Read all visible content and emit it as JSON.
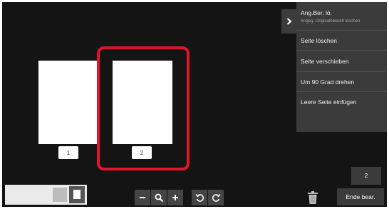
{
  "sidebar": {
    "items": [
      {
        "label": "Ang.Ber. lö.",
        "sublabel": "Angeg. Originalbereich löschen"
      },
      {
        "label": "Seite löschen"
      },
      {
        "label": "Seite verschieben"
      },
      {
        "label": "Um 90 Grad drehen"
      },
      {
        "label": "Leere Seite einfügen"
      }
    ],
    "expand_icon": "chevron-right-icon"
  },
  "pages": [
    {
      "number": "1",
      "selected": false
    },
    {
      "number": "2",
      "selected": true
    }
  ],
  "bottom": {
    "page_count": "2",
    "end_edit_label": "Ende bear.",
    "tools": [
      "zoom-out-icon",
      "magnifier-icon",
      "zoom-in-icon",
      "rotate-left-icon",
      "rotate-right-icon"
    ],
    "trash_icon": "trash-icon"
  },
  "colors": {
    "background": "#141414",
    "panel": "#3b3b3b",
    "selection": "#e0152b"
  }
}
